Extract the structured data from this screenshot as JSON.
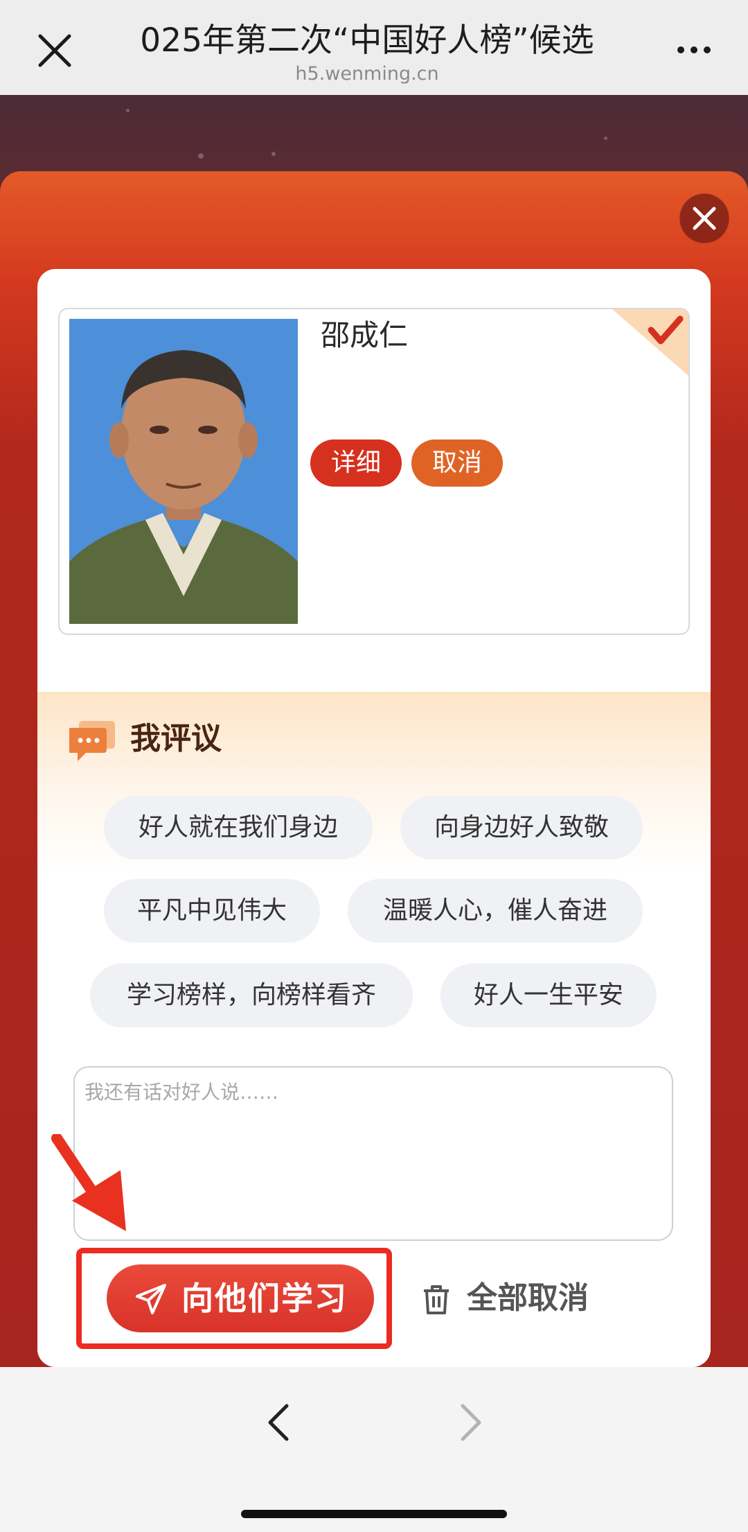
{
  "browser": {
    "title": "025年第二次“中国好人榜”候选",
    "domain": "h5.wenming.cn"
  },
  "candidate": {
    "name": "邵成仁",
    "detail_label": "详细",
    "cancel_label": "取消"
  },
  "comment": {
    "title": "我评议",
    "tags": [
      "好人就在我们身边",
      "向身边好人致敬",
      "平凡中见伟大",
      "温暖人心，催人奋进",
      "学习榜样，向榜样看齐",
      "好人一生平安"
    ],
    "placeholder": "我还有话对好人说……"
  },
  "actions": {
    "learn_label": "向他们学习",
    "cancel_all_label": "全部取消"
  },
  "colors": {
    "accent_red": "#d6301f",
    "accent_orange": "#e06326",
    "highlight_red": "#ec2b21"
  },
  "icons": [
    "close-icon",
    "more-icon",
    "panel-close-icon",
    "checkmark-icon",
    "comment-icon",
    "send-icon",
    "trash-icon",
    "back-icon",
    "forward-icon"
  ]
}
